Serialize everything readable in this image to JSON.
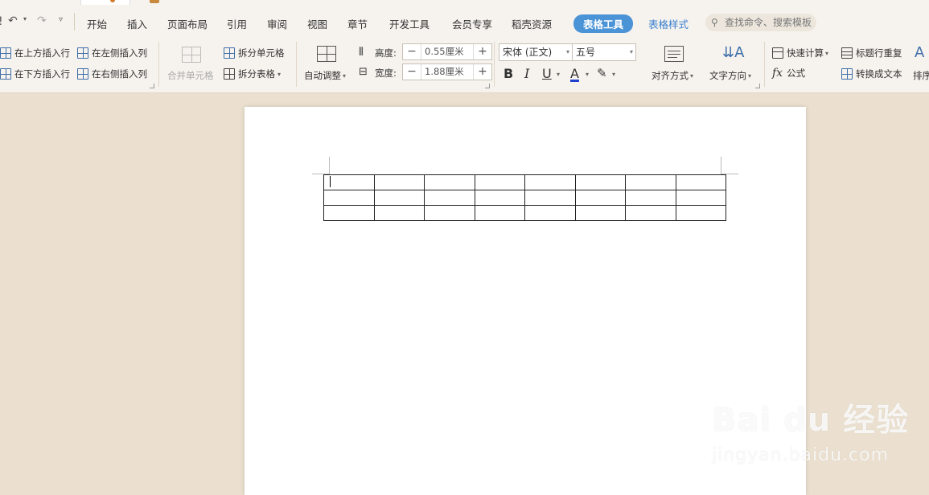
{
  "quick_access": {
    "undo_icon": "undo-icon",
    "redo_icon": "redo-icon"
  },
  "menu": {
    "items": [
      "开始",
      "插入",
      "页面布局",
      "引用",
      "审阅",
      "视图",
      "章节",
      "开发工具",
      "会员专享",
      "稻壳资源"
    ],
    "active_tab": "表格工具",
    "next_tab": "表格样式",
    "search_placeholder": "查找命令、搜索模板"
  },
  "ribbon": {
    "insert_above": "在上方插入行",
    "insert_below": "在下方插入行",
    "insert_left": "在左侧插入列",
    "insert_right": "在右侧插入列",
    "merge_cells": "合并单元格",
    "split_cells": "拆分单元格",
    "split_table": "拆分表格",
    "auto_fit": "自动调整",
    "height_label": "高度:",
    "height_value": "0.55厘米",
    "width_label": "宽度:",
    "width_value": "1.88厘米",
    "font_name": "宋体 (正文)",
    "font_size": "五号",
    "align": "对齐方式",
    "text_dir": "文字方向",
    "quick_calc": "快速计算",
    "formula": "公式",
    "repeat_header": "标题行重复",
    "to_text": "转换成文本",
    "sort": "排序",
    "colors": {
      "accent": "#4a93d6",
      "font_color": "#1f3fcf"
    }
  },
  "document": {
    "table_rows": 3,
    "table_cols": 8
  },
  "watermark": {
    "brand": "Bai du 经验",
    "url": "jingyan.baidu.com"
  }
}
